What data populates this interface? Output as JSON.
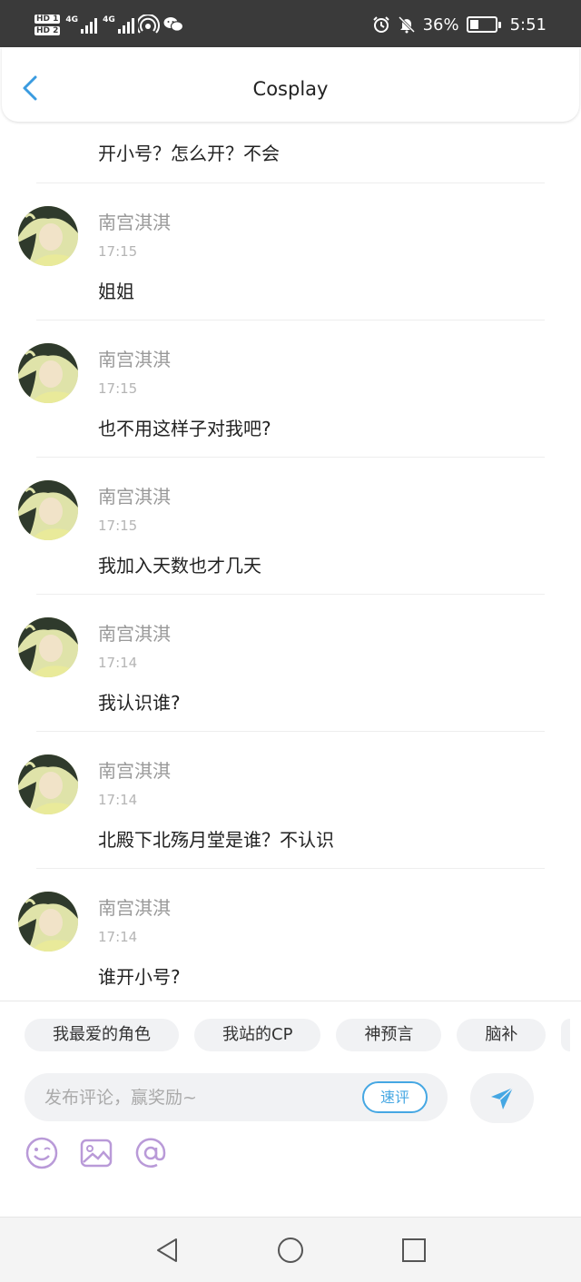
{
  "status_bar": {
    "sim1": "HD 1",
    "sim2": "HD 2",
    "network": "4G",
    "battery_percent": "36%",
    "battery_level": 0.36,
    "time": "5:51"
  },
  "header": {
    "title": "Cosplay"
  },
  "partial_comment": {
    "text": "开小号？怎么开？不会"
  },
  "comments": [
    {
      "user": "南宫淇淇",
      "time": "17:15",
      "text": "姐姐"
    },
    {
      "user": "南宫淇淇",
      "time": "17:15",
      "text": "也不用这样子对我吧?"
    },
    {
      "user": "南宫淇淇",
      "time": "17:15",
      "text": "我加入天数也才几天"
    },
    {
      "user": "南宫淇淇",
      "time": "17:14",
      "text": "我认识谁?"
    },
    {
      "user": "南宫淇淇",
      "time": "17:14",
      "text": "北殿下北殇月堂是谁？不认识"
    },
    {
      "user": "南宫淇淇",
      "time": "17:14",
      "text": "谁开小号?"
    }
  ],
  "chips": [
    "我最爱的角色",
    "我站的CP",
    "神预言",
    "脑补"
  ],
  "comment_box": {
    "placeholder": "发布评论，赢奖励~",
    "quick_label": "速评"
  },
  "colors": {
    "accent": "#45a7e3",
    "tool_icon": "#b99ad8",
    "status_bar_bg": "#3a3a3a"
  },
  "icons": {
    "back": "chevron-left-icon",
    "send": "paper-plane-icon",
    "emoji": "smiley-icon",
    "image": "image-icon",
    "mention": "at-icon",
    "nav_back": "triangle-back-icon",
    "nav_home": "circle-home-icon",
    "nav_recent": "square-recent-icon"
  }
}
